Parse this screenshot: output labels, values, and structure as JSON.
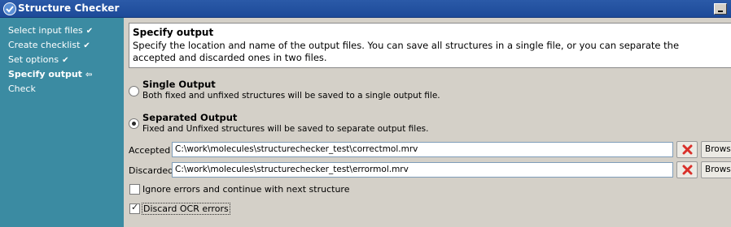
{
  "window": {
    "title": "Structure Checker"
  },
  "sidebar": {
    "steps": [
      {
        "label": "Select input files",
        "mark": "✔"
      },
      {
        "label": "Create checklist",
        "mark": "✔"
      },
      {
        "label": "Set options",
        "mark": "✔"
      },
      {
        "label": "Specify output",
        "mark": "⇦"
      },
      {
        "label": "Check",
        "mark": ""
      }
    ]
  },
  "header": {
    "title": "Specify output",
    "description": "Specify the location and name of the output files. You can save all structures in a single file, or you can separate the accepted and discarded ones in two files."
  },
  "options": {
    "single": {
      "title": "Single Output",
      "description": "Both fixed and unfixed structures will be saved to a single output file.",
      "selected": false
    },
    "separated": {
      "title": "Separated Output",
      "description": "Fixed and Unfixed structures will be saved to separate output files.",
      "selected": true
    }
  },
  "files": {
    "accepted": {
      "label": "Accepted",
      "value": "C:\\work\\molecules\\structurechecker_test\\correctmol.mrv",
      "browse_label": "Browse"
    },
    "discarded": {
      "label": "Discarded",
      "value": "C:\\work\\molecules\\structurechecker_test\\errormol.mrv",
      "browse_label": "Browse"
    }
  },
  "checkboxes": {
    "ignore_errors": {
      "label": "Ignore errors and continue with next structure",
      "checked": false
    },
    "discard_ocr": {
      "label": "Discard OCR errors",
      "checked": true
    }
  },
  "colors": {
    "sidebar": "#3b8ba2",
    "titlebar": "#2b5aa8",
    "clear_icon": "#d9302a"
  }
}
